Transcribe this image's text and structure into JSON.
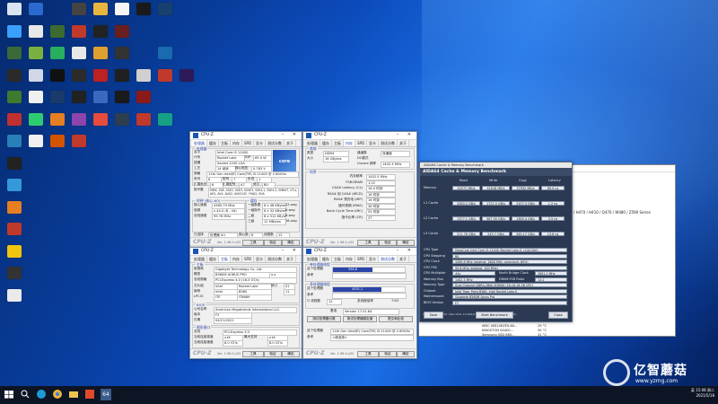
{
  "desktop_icons": [
    {
      "label": "",
      "color": "#d8e4f0",
      "col": 0,
      "row": 0
    },
    {
      "label": "",
      "color": "#2a6ad0",
      "col": 1,
      "row": 0
    },
    {
      "label": "",
      "color": "#444",
      "col": 3,
      "row": 0
    },
    {
      "label": "",
      "color": "#e8b640",
      "col": 4,
      "row": 0
    },
    {
      "label": "",
      "color": "#f5f5f5",
      "col": 5,
      "row": 0
    },
    {
      "label": "",
      "color": "#1a1a1a",
      "col": 6,
      "row": 0
    },
    {
      "label": "",
      "color": "#17406e",
      "col": 7,
      "row": 0
    },
    {
      "label": "",
      "color": "#3aa0ff",
      "col": 0,
      "row": 1
    },
    {
      "label": "",
      "color": "#e8e8e8",
      "col": 1,
      "row": 1
    },
    {
      "label": "",
      "color": "#3c6b2f",
      "col": 2,
      "row": 1
    },
    {
      "label": "",
      "color": "#c0392b",
      "col": 3,
      "row": 1
    },
    {
      "label": "",
      "color": "#222",
      "col": 4,
      "row": 1
    },
    {
      "label": "",
      "color": "#6b1e1e",
      "col": 5,
      "row": 1
    },
    {
      "label": "",
      "color": "#3a6a3a",
      "col": 0,
      "row": 2
    },
    {
      "label": "",
      "color": "#7ab040",
      "col": 1,
      "row": 2
    },
    {
      "label": "",
      "color": "#27ae60",
      "col": 2,
      "row": 2
    },
    {
      "label": "",
      "color": "#e8e8e8",
      "col": 3,
      "row": 2
    },
    {
      "label": "",
      "color": "#e0a030",
      "col": 4,
      "row": 2
    },
    {
      "label": "",
      "color": "#333",
      "col": 5,
      "row": 2
    },
    {
      "label": "",
      "color": "#1a6ab0",
      "col": 7,
      "row": 2
    },
    {
      "label": "",
      "color": "#2a2a2a",
      "col": 0,
      "row": 3
    },
    {
      "label": "",
      "color": "#d0d8e8",
      "col": 1,
      "row": 3
    },
    {
      "label": "",
      "color": "#111",
      "col": 2,
      "row": 3
    },
    {
      "label": "",
      "color": "#2b2b2b",
      "col": 3,
      "row": 3
    },
    {
      "label": "",
      "color": "#b22",
      "col": 4,
      "row": 3
    },
    {
      "label": "",
      "color": "#202020",
      "col": 5,
      "row": 3
    },
    {
      "label": "",
      "color": "#d0d0d0",
      "col": 6,
      "row": 3
    },
    {
      "label": "",
      "color": "#c0392b",
      "col": 7,
      "row": 3
    },
    {
      "label": "",
      "color": "#2d1a5a",
      "col": 8,
      "row": 3
    },
    {
      "label": "",
      "color": "#3e7b2f",
      "col": 0,
      "row": 4
    },
    {
      "label": "",
      "color": "#f0f0f0",
      "col": 1,
      "row": 4
    },
    {
      "label": "",
      "color": "#1a3a6a",
      "col": 2,
      "row": 4
    },
    {
      "label": "",
      "color": "#222",
      "col": 3,
      "row": 4
    },
    {
      "label": "",
      "color": "#3a6abf",
      "col": 4,
      "row": 4
    },
    {
      "label": "",
      "color": "#1a1a1a",
      "col": 5,
      "row": 4
    },
    {
      "label": "",
      "color": "#8a1a1a",
      "col": 6,
      "row": 4
    },
    {
      "label": "",
      "color": "#c03030",
      "col": 0,
      "row": 5
    },
    {
      "label": "",
      "color": "#2ecc71",
      "col": 1,
      "row": 5
    },
    {
      "label": "",
      "color": "#e67e22",
      "col": 2,
      "row": 5
    },
    {
      "label": "",
      "color": "#8e44ad",
      "col": 3,
      "row": 5
    },
    {
      "label": "",
      "color": "#e74c3c",
      "col": 4,
      "row": 5
    },
    {
      "label": "",
      "color": "#2c3e50",
      "col": 5,
      "row": 5
    },
    {
      "label": "",
      "color": "#c0392b",
      "col": 6,
      "row": 5
    },
    {
      "label": "",
      "color": "#16a085",
      "col": 7,
      "row": 5
    },
    {
      "label": "",
      "color": "#2980b9",
      "col": 0,
      "row": 6
    },
    {
      "label": "",
      "color": "#f0f0f0",
      "col": 1,
      "row": 6
    },
    {
      "label": "",
      "color": "#d35400",
      "col": 2,
      "row": 6
    },
    {
      "label": "",
      "color": "#c0392b",
      "col": 3,
      "row": 6
    },
    {
      "label": "",
      "color": "#222",
      "col": 0,
      "row": 7
    },
    {
      "label": "",
      "color": "#3498db",
      "col": 0,
      "row": 8
    },
    {
      "label": "",
      "color": "#e67e22",
      "col": 0,
      "row": 9
    },
    {
      "label": "",
      "color": "#c0392b",
      "col": 0,
      "row": 10
    },
    {
      "label": "",
      "color": "#f1c40f",
      "col": 0,
      "row": 11
    },
    {
      "label": "",
      "color": "#333",
      "col": 0,
      "row": 12
    },
    {
      "label": "",
      "color": "#eaeaea",
      "col": 0,
      "row": 13
    }
  ],
  "cpuz_cpu": {
    "title": "CPU-Z",
    "tabs": [
      "处理器",
      "缓存",
      "主板",
      "内存",
      "SPD",
      "显卡",
      "测试分数",
      "关于"
    ],
    "name_label": "名字",
    "name": "Intel Core i5 11400",
    "code_label": "代号",
    "code": "Rocket Lake",
    "tdp_label": "TDP",
    "tdp": "65.0 W",
    "socket_label": "插槽",
    "socket": "Socket 1200 LGA",
    "tech_label": "工艺",
    "tech": "14 纳米",
    "volt_label": "核心电压",
    "volt": "0.783 V",
    "spec_label": "规格",
    "spec": "11th Gen Intel(R) Core(TM) i5-11400 @ 2.60GHz",
    "family_label": "系列",
    "family": "6",
    "model_label": "型号",
    "model": "7",
    "step_label": "步进",
    "step": "1",
    "extfam_label": "扩展系列",
    "extfam": "6",
    "extmod_label": "扩展型号",
    "extmod": "A7",
    "rev_label": "修订",
    "rev": "B0",
    "instr_label": "指令集",
    "instr": "MMX, SSE, SSE2, SSE3, SSSE3, SSE4.1, SSE4.2, EM64T, VT-x, AES, AVX, AVX2, AVX512F, FMA3, SHA",
    "clock_group": "时钟 (核心 #0)",
    "core_speed_label": "核心速度",
    "core_speed": "4389.79 MHz",
    "mult_label": "倍频",
    "mult": "x 44.0 (8 - 44)",
    "bus_label": "总线速度",
    "bus": "99.76 MHz",
    "cache_group": "缓存",
    "l1d_label": "一级数据",
    "l1d": "6 x 48 KBytes",
    "l1d_way": "12-way",
    "l1i_label": "一级指令",
    "l1i": "6 x 32 KBytes",
    "l1i_way": "8-way",
    "l2_label": "二级",
    "l2": "6 x 512 KBytes",
    "l2_way": "8-way",
    "l3_label": "三级",
    "l3": "12 MBytes",
    "l3_way": "16-way",
    "sel_label": "已选择",
    "sel": "处理器 #1",
    "cores_label": "核心数",
    "cores": "6",
    "threads_label": "线程数",
    "threads": "12",
    "version": "Ver. 1.96.0.x32",
    "tools": "工具",
    "ok": "验证",
    "close": "确定"
  },
  "cpuz_mem": {
    "title": "CPU-Z",
    "tabs": [
      "处理器",
      "缓存",
      "主板",
      "内存",
      "SPD",
      "显卡",
      "测试分数",
      "关于"
    ],
    "general_group": "常规",
    "type_label": "类型",
    "type": "DDR4",
    "channel_label": "通道数",
    "channel": "双通道",
    "size_label": "大小",
    "size": "16 GBytes",
    "dc_label": "DC模式",
    "nb_label": "Uncore 频率",
    "nb": "1402.3 MHz",
    "timing_group": "时序",
    "dram_freq_label": "内存频率",
    "dram_freq": "1402.5 MHz",
    "fsb_label": "FSB:DRAM",
    "fsb": "1:22",
    "cl_label": "CAS# Latency (CL)",
    "cl": "16.0 时钟",
    "trcd_label": "RAS# 到 CAS# (tRCD)",
    "trcd": "16 时钟",
    "trp_label": "RAS# 预充电 (tRP)",
    "trp": "16 时钟",
    "tras_label": "循环周期 (tRAS)",
    "tras": "36 时钟",
    "trc_label": "Bank Cycle Time (tRC)",
    "trc": "52 时钟",
    "cr_label": "指令比率 (CR)",
    "cr": "2T",
    "version": "Ver. 1.96.0.x32",
    "tools": "工具",
    "ok": "验证",
    "close": "确定"
  },
  "cpuz_mb": {
    "title": "CPU-Z",
    "tabs": [
      "处理器",
      "缓存",
      "主板",
      "内存",
      "SPD",
      "显卡",
      "测试分数",
      "关于"
    ],
    "mb_group": "主板",
    "maker_label": "制造商",
    "maker": "Gigabyte Technology Co. Ltd.",
    "model_label": "模型",
    "model": "B560M AORUS PRO",
    "model_rev": "x.x",
    "bus_label": "总线规格",
    "bus": "PCI-Express 4.0 (16.0 GT/s)",
    "chipset_label": "芯片组",
    "chipset": "Intel",
    "chipset_code": "Rocket Lake",
    "chipset_rev_label": "修订",
    "chipset_rev": "01",
    "south_label": "南桥",
    "south": "Intel",
    "south_code": "B560",
    "south_rev": "11",
    "lpcio_label": "LPCIO",
    "lpcio": "ITE",
    "lpcio_code": "IT8689",
    "bios_group": "BIOS",
    "brand_label": "公司名称",
    "brand": "American Megatrends International LLC.",
    "bver_label": "版本",
    "bver": "F2",
    "date_label": "日期",
    "date": "04/21/2021",
    "gfx_group": "图形接口",
    "gbus_label": "总线",
    "gbus": "PCI-Express 3.0",
    "glink_label": "当前连接宽度",
    "glink": "x16",
    "gmax_label": "最大支持",
    "gmax": "x16",
    "gspeed_label": "当前连接速度",
    "gspeed": "8.0 GT/s",
    "gmaxs": "8.0 GT/s",
    "version": "Ver. 1.96.0.x32",
    "tools": "工具",
    "ok": "验证",
    "close": "确定"
  },
  "cpuz_bench": {
    "title": "CPU-Z",
    "tabs": [
      "处理器",
      "缓存",
      "主板",
      "内存",
      "SPD",
      "显卡",
      "测试分数",
      "关于"
    ],
    "single_group": "单处理器线程",
    "this_label": "这个处理器",
    "this_val": "596.8",
    "ref_label": "参考",
    "multi_group": "多处理器线程",
    "mthis_label": "这个处理器",
    "mthis_val": "4551.1",
    "mref_label": "参考",
    "single_ratio": 0.55,
    "multi_ratio": 0.68,
    "threads_label": "线程数",
    "threads": "12",
    "ratio_label": "多线程倍率",
    "ratio": "7.63",
    "base_label": "基准",
    "base": "Version 17.01.64",
    "bench_btn": "测试处理器分数",
    "stress_btn": "测试处理器稳定度",
    "submit_btn": "提交和比较",
    "this_proc_label": "这个处理器",
    "this_proc": "11th Gen Intel(R) Core(TM) i5-11400 @ 2.60GHz",
    "ref_proc_label": "参考",
    "ref_proc": "<请选择>",
    "version": "Ver. 1.96.0.x32",
    "tools": "工具",
    "ok": "验证",
    "close": "确定"
  },
  "aida": {
    "titlebar": "AIDA64 Cache & Memory Benchmark",
    "header": "AIDA64 Cache & Memory Benchmark",
    "cols": [
      "Read",
      "Write",
      "Copy",
      "Latency"
    ],
    "rows": [
      {
        "name": "Memory",
        "vals": [
          "42072 MB/s",
          "41618 MB/s",
          "37992 MB/s",
          "69.9 ns"
        ]
      },
      {
        "name": "L1 Cache",
        "vals": [
          "3280.2 GB/s",
          "1721.5 GB/s",
          "3107.3 GB/s",
          "1.2 ns"
        ]
      },
      {
        "name": "L2 Cache",
        "vals": [
          "1377.1 GB/s",
          "967.55 GB/s",
          "1365.4 GB/s",
          "3.5 ns"
        ]
      },
      {
        "name": "L3 Cache",
        "vals": [
          "511.76 GB/s",
          "245.7 GB/s",
          "349.17 GB/s",
          "13.6 ns"
        ]
      }
    ],
    "info": [
      {
        "k": "CPU Type",
        "v": "HexaCore Intel Core i5-11400 (Rocket Lake-S, LGA1200)"
      },
      {
        "k": "CPU Stepping",
        "v": "B0"
      },
      {
        "k": "CPU Clock",
        "v": "4389.8 MHz (original: 2600 MHz, overclock: 69%)"
      },
      {
        "k": "CPU FSB",
        "v": "99.8 MHz (original: 100 MHz)"
      },
      {
        "k": "CPU Multiplier",
        "v": "44x"
      },
      {
        "k": "Memory Bus",
        "v": "1402.5 MHz"
      },
      {
        "k": "Memory Type",
        "v": "Dual Channel DDR4-2800 SDRAM (16-16-16-36 CR2)"
      },
      {
        "k": "Chipset",
        "v": "Intel Tiger Point B560, Intel Rocket Lake-S"
      },
      {
        "k": "Motherboard",
        "v": "Gigabyte B560M Aorus Pro"
      },
      {
        "k": "BIOS Version",
        "v": "F2"
      }
    ],
    "nb_clock_label": "North Bridge Clock",
    "nb_clock": "2801.2 MHz",
    "dram_fsb_label": "DRAM:FSB Ratio",
    "dram_fsb": "14:1",
    "footer": "AIDA64 v6.33.5700 / BenchDLL 4.5.846.8-x64 (c) 1995-2021 FinalWire Ltd.",
    "save": "Save",
    "start": "Start Benchmark",
    "close": "Close"
  },
  "back_window": {
    "title": "AIDA64 Business",
    "tail_text": "/ H470 / H410 / Q470 / W480 / Z590 Series",
    "sensors": [
      {
        "name": "Hitachi HDS721010...",
        "val": "45 °C"
      },
      {
        "name": "WDC WD10EZEX-60...",
        "val": "29 °C"
      },
      {
        "name": "KINGSTON SA400...",
        "val": "30 °C"
      },
      {
        "name": "Samsung SSD 860...",
        "val": "31 °C"
      }
    ]
  },
  "taskbar": {
    "time": "15:08 周二",
    "date": "2021/5/18",
    "lang": "英"
  },
  "watermark": {
    "text": "亿智蘑菇",
    "url": "www.yzmg.com"
  }
}
